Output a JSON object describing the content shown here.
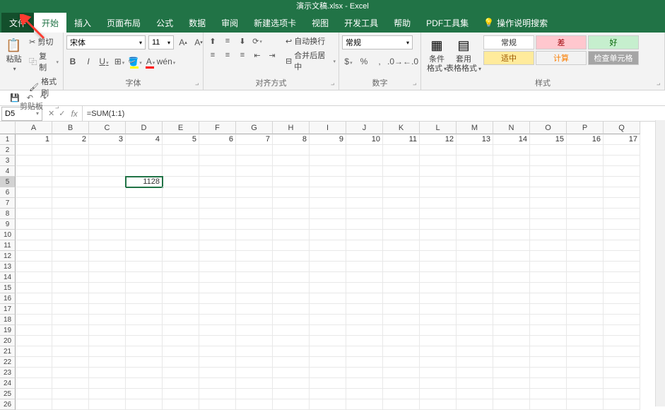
{
  "title": "演示文稿.xlsx  -  Excel",
  "tabs": {
    "file": "文件",
    "home": "开始",
    "insert": "插入",
    "layout": "页面布局",
    "formulas": "公式",
    "data": "数据",
    "review": "审阅",
    "newtab": "新建选项卡",
    "view": "视图",
    "developer": "开发工具",
    "help": "帮助",
    "pdf": "PDF工具集",
    "tellme": "操作说明搜索"
  },
  "ribbon": {
    "clipboard": {
      "label": "剪贴板",
      "paste": "粘贴",
      "cut": "剪切",
      "copy": "复制",
      "format_painter": "格式刷"
    },
    "font": {
      "label": "字体",
      "name": "宋体",
      "size": "11"
    },
    "align": {
      "label": "对齐方式",
      "wrap": "自动换行",
      "merge": "合并后居中"
    },
    "number": {
      "label": "数字",
      "format": "常规"
    },
    "styles": {
      "label": "样式",
      "cond": "条件格式",
      "table": "套用\n表格格式",
      "normal": "常规",
      "bad": "差",
      "good": "好",
      "neutral": "适中",
      "calc": "计算",
      "check": "检查单元格"
    }
  },
  "formula_bar": {
    "cell_ref": "D5",
    "formula": "=SUM(1:1)"
  },
  "columns": [
    "A",
    "B",
    "C",
    "D",
    "E",
    "F",
    "G",
    "H",
    "I",
    "J",
    "K",
    "L",
    "M",
    "N",
    "O",
    "P",
    "Q"
  ],
  "row_count": 26,
  "cells": {
    "row1": [
      "1",
      "2",
      "3",
      "4",
      "5",
      "6",
      "7",
      "8",
      "9",
      "10",
      "11",
      "12",
      "13",
      "14",
      "15",
      "16",
      "17"
    ],
    "D5": "1128"
  },
  "active_cell": {
    "row": 5,
    "col": "D"
  }
}
